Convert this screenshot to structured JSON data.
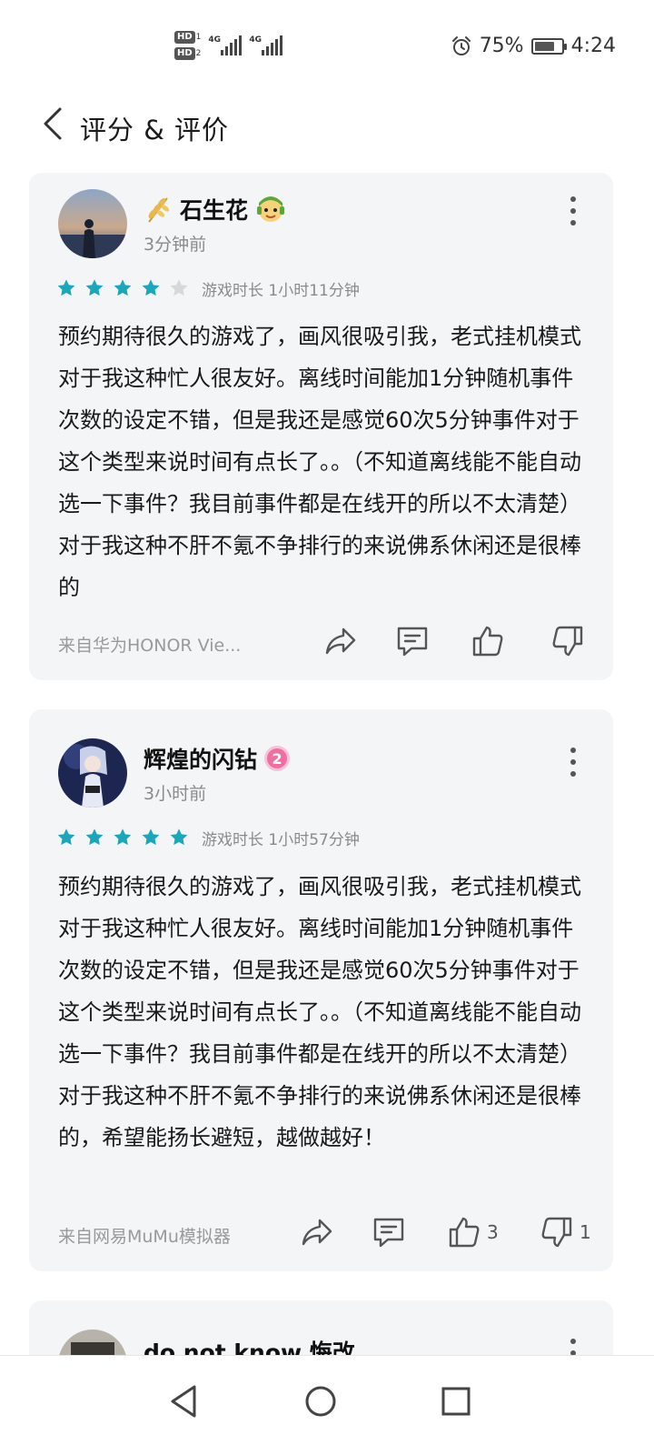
{
  "status_bar": {
    "hd1": "HD",
    "hd1_sub": "1",
    "hd2": "HD",
    "hd2_sub": "2",
    "net1": "4G",
    "net2": "4G",
    "battery_percent": "75%",
    "battery_level": 0.75,
    "time": "4:24"
  },
  "header": {
    "title": "评分 & 评价"
  },
  "reviews": [
    {
      "username": "石生花",
      "time_ago": "3分钟前",
      "rating": 4,
      "playtime": "游戏时长 1小时11分钟",
      "text": "预约期待很久的游戏了，画风很吸引我，老式挂机模式对于我这种忙人很友好。离线时间能加1分钟随机事件次数的设定不错，但是我还是感觉60次5分钟事件对于这个类型来说时间有点长了。。（不知道离线能不能自动选一下事件？我目前事件都是在线开的所以不太清楚）对于我这种不肝不氪不争排行的来说佛系休闲还是很棒的",
      "device": "来自华为HONOR Vie...",
      "like_count": "",
      "dislike_count": ""
    },
    {
      "username": "辉煌的闪钻",
      "badge": "2",
      "time_ago": "3小时前",
      "rating": 5,
      "playtime": "游戏时长 1小时57分钟",
      "text": "预约期待很久的游戏了，画风很吸引我，老式挂机模式对于我这种忙人很友好。离线时间能加1分钟随机事件次数的设定不错，但是我还是感觉60次5分钟事件对于这个类型来说时间有点长了。。（不知道离线能不能自动选一下事件？我目前事件都是在线开的所以不太清楚）对于我这种不肝不氪不争排行的来说佛系休闲还是很棒的，希望能扬长避短，越做越好！",
      "device": "来自网易MuMu模拟器",
      "like_count": "3",
      "dislike_count": "1"
    },
    {
      "username": "do not know 悔改"
    }
  ],
  "colors": {
    "star_filled": "#1aa7b8",
    "star_empty": "#d8d8d8",
    "card_bg": "#f4f5f7",
    "badge_pink": "#f06fa3"
  },
  "icons": {
    "back": "chevron-left-icon",
    "more": "more-vertical-icon",
    "share": "share-icon",
    "comment": "comment-icon",
    "like": "thumbs-up-icon",
    "dislike": "thumbs-down-icon",
    "nav_back": "nav-back-icon",
    "nav_home": "nav-home-icon",
    "nav_recent": "nav-recent-icon"
  }
}
